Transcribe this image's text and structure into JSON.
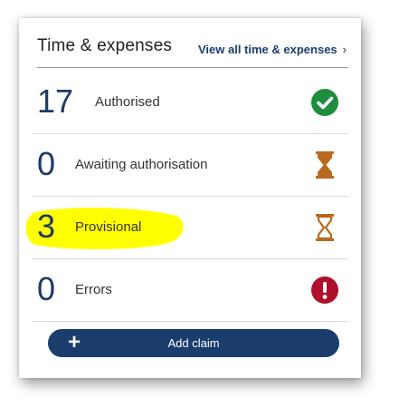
{
  "widget": {
    "title": "Time & expenses",
    "view_all_link": "View all time & expenses",
    "view_all_chevron": "›"
  },
  "rows": [
    {
      "count": "17",
      "label": "Authorised",
      "icon": "check-circle-icon",
      "icon_color": "#1e8e3e"
    },
    {
      "count": "0",
      "label": "Awaiting authorisation",
      "icon": "hourglass-filled-icon",
      "icon_color": "#b86a1e"
    },
    {
      "count": "3",
      "label": "Provisional",
      "icon": "hourglass-outline-icon",
      "icon_color": "#b86a1e",
      "highlighted": true
    },
    {
      "count": "0",
      "label": "Errors",
      "icon": "exclamation-circle-icon",
      "icon_color": "#b0102a"
    }
  ],
  "add_button": {
    "plus": "+",
    "label": "Add claim"
  },
  "colors": {
    "accent": "#1b3e73",
    "button_bg": "#1a3d6e",
    "highlight": "#ffff00"
  }
}
